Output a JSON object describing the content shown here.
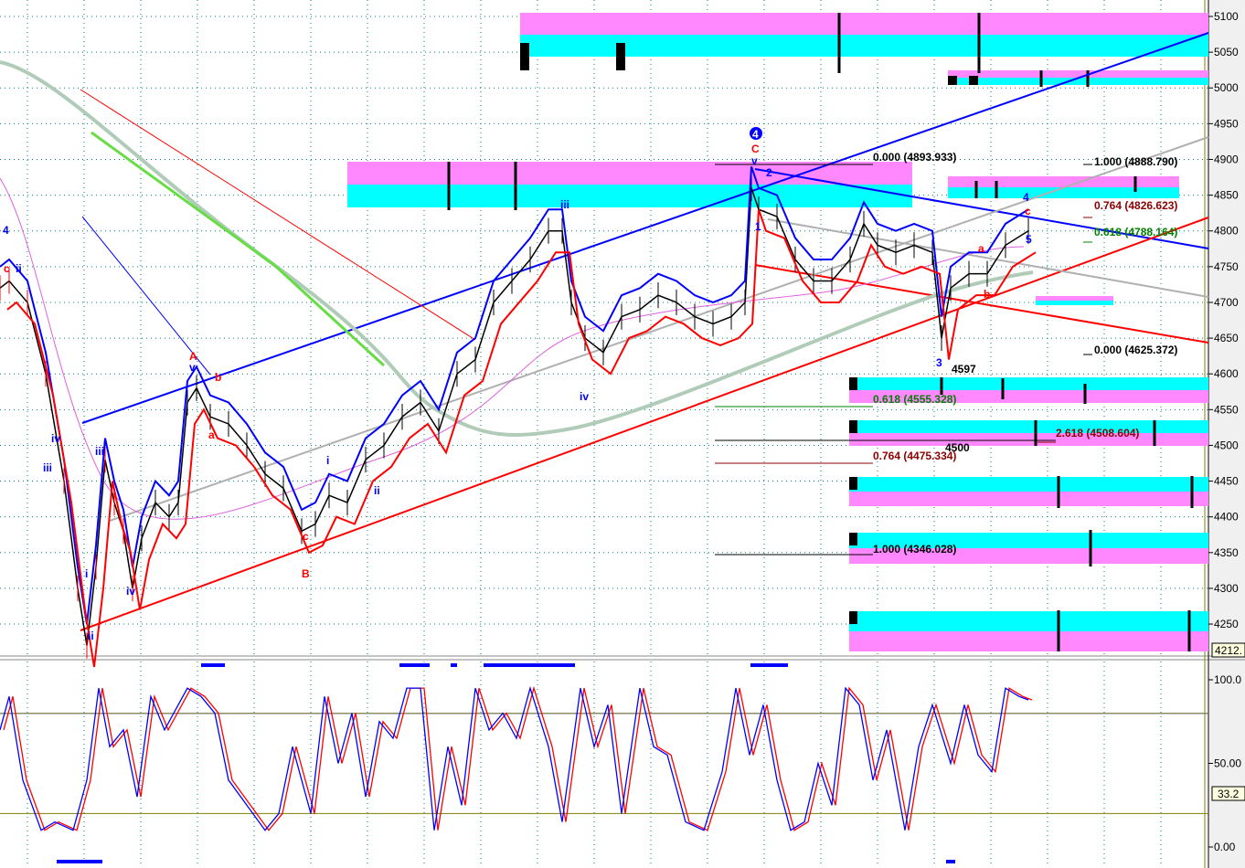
{
  "chart_data": {
    "type": "line",
    "title": "",
    "price_axis": {
      "ylim": [
        4212,
        5120
      ],
      "ticks": [
        "5100",
        "5050",
        "5000",
        "4950",
        "4900",
        "4850",
        "4800",
        "4750",
        "4700",
        "4650",
        "4600",
        "4550",
        "4500",
        "4450",
        "4400",
        "4350",
        "4300",
        "4250"
      ],
      "tick_values": [
        5100,
        5050,
        5000,
        4950,
        4900,
        4850,
        4800,
        4750,
        4700,
        4650,
        4600,
        4550,
        4500,
        4450,
        4400,
        4350,
        4300,
        4250
      ],
      "current_label": "4212."
    },
    "osc_axis": {
      "ylim": [
        0,
        100
      ],
      "ticks": [
        "100.0",
        "50.00",
        "0.00"
      ],
      "tick_values": [
        100,
        50,
        0
      ],
      "current_label": "33.2",
      "levels": [
        80,
        20
      ]
    },
    "price": {
      "bar": [
        0,
        10,
        30,
        50,
        70,
        85,
        95,
        105,
        115,
        125,
        135,
        145,
        155,
        170,
        185,
        195,
        205,
        215,
        230,
        250,
        270,
        290,
        310,
        330,
        345,
        360,
        380,
        400,
        420,
        440,
        460,
        480,
        500,
        520,
        540,
        560,
        580,
        600,
        615,
        625,
        640,
        660,
        680,
        700,
        720,
        740,
        760,
        780,
        800,
        815,
        822,
        830,
        850,
        870,
        890,
        910,
        930,
        945,
        960,
        980,
        1000,
        1020,
        1030,
        1040,
        1060,
        1080,
        1100,
        1125
      ],
      "close": [
        4720,
        4730,
        4700,
        4600,
        4450,
        4300,
        4220,
        4330,
        4480,
        4420,
        4380,
        4300,
        4370,
        4420,
        4400,
        4420,
        4560,
        4580,
        4540,
        4530,
        4500,
        4460,
        4440,
        4380,
        4390,
        4430,
        4420,
        4480,
        4500,
        4540,
        4560,
        4520,
        4600,
        4620,
        4700,
        4730,
        4760,
        4800,
        4800,
        4700,
        4650,
        4630,
        4680,
        4690,
        4710,
        4700,
        4680,
        4670,
        4680,
        4700,
        4860,
        4830,
        4820,
        4760,
        4730,
        4730,
        4760,
        4810,
        4780,
        4770,
        4780,
        4770,
        4650,
        4720,
        4740,
        4740,
        4780,
        4800
      ]
    },
    "oscillator": {
      "bar": [
        0,
        10,
        25,
        45,
        60,
        80,
        95,
        108,
        120,
        135,
        150,
        165,
        180,
        195,
        205,
        220,
        235,
        250,
        270,
        290,
        305,
        320,
        340,
        355,
        370,
        385,
        400,
        415,
        430,
        445,
        460,
        475,
        490,
        505,
        520,
        535,
        550,
        565,
        580,
        600,
        615,
        635,
        650,
        665,
        680,
        700,
        715,
        730,
        750,
        770,
        790,
        805,
        820,
        835,
        850,
        865,
        880,
        895,
        910,
        925,
        940,
        955,
        970,
        990,
        1005,
        1020,
        1040,
        1055,
        1070,
        1085,
        1100,
        1115,
        1125
      ],
      "k": [
        70,
        90,
        40,
        10,
        15,
        10,
        40,
        95,
        60,
        70,
        30,
        90,
        70,
        85,
        95,
        90,
        80,
        40,
        25,
        10,
        20,
        60,
        20,
        90,
        50,
        80,
        30,
        75,
        65,
        95,
        95,
        10,
        60,
        25,
        95,
        70,
        80,
        65,
        95,
        60,
        15,
        95,
        60,
        85,
        20,
        95,
        60,
        55,
        15,
        10,
        45,
        95,
        55,
        85,
        40,
        10,
        15,
        50,
        25,
        95,
        85,
        40,
        70,
        10,
        60,
        85,
        50,
        85,
        55,
        45,
        95,
        90,
        88
      ]
    },
    "wave_labels": [
      "4",
      "c",
      "ii",
      "iii",
      "iv",
      "i",
      "ii",
      "iii",
      "iv",
      "A",
      "v",
      "b",
      "a",
      "c",
      "B",
      "i",
      "ii",
      "iii",
      "iv",
      "4",
      "C",
      "v",
      "2",
      "1",
      "3",
      "4",
      "c",
      "a",
      "b",
      "5"
    ],
    "fib_labels": [
      "0.000 (4893.933)",
      "1.000 (4888.790)",
      "0.764 (4826.623)",
      "0.618 (4788.164)",
      "0.000 (4625.372)",
      "0.618 (4555.328)",
      "2.618 (4508.604)",
      "0.764 (4475.334)",
      "1.000 (4346.028)"
    ],
    "price_marks": [
      "4597",
      "4500"
    ],
    "colors": {
      "magenta": "#ff88ff",
      "cyan": "#00ffff",
      "blue": "#0000ff",
      "red": "#ff0000",
      "grid": "#008080",
      "ma": "#b0ccb8",
      "green": "#008000",
      "darkred": "#8b0000"
    }
  }
}
